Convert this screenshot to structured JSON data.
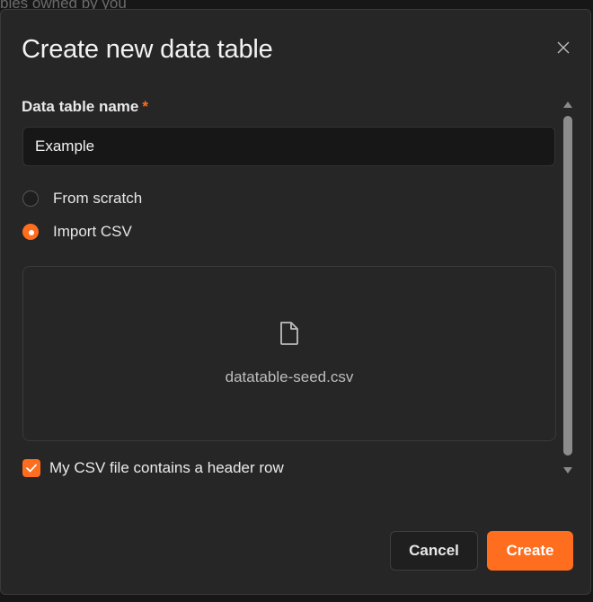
{
  "background": {
    "partial_text": "bles owned by you"
  },
  "dialog": {
    "title": "Create new data table",
    "close_icon": "close-icon"
  },
  "form": {
    "name_label": "Data table name",
    "required_marker": "*",
    "name_value": "Example",
    "options": [
      {
        "label": "From scratch",
        "selected": false
      },
      {
        "label": "Import CSV",
        "selected": true
      }
    ],
    "file_icon": "file-icon",
    "file_name": "datatable-seed.csv",
    "header_row_label": "My CSV file contains a header row",
    "header_row_checked": true
  },
  "footer": {
    "cancel_label": "Cancel",
    "create_label": "Create"
  },
  "colors": {
    "accent": "#ff6d1f",
    "dialog_bg": "#262626",
    "input_bg": "#171717"
  }
}
